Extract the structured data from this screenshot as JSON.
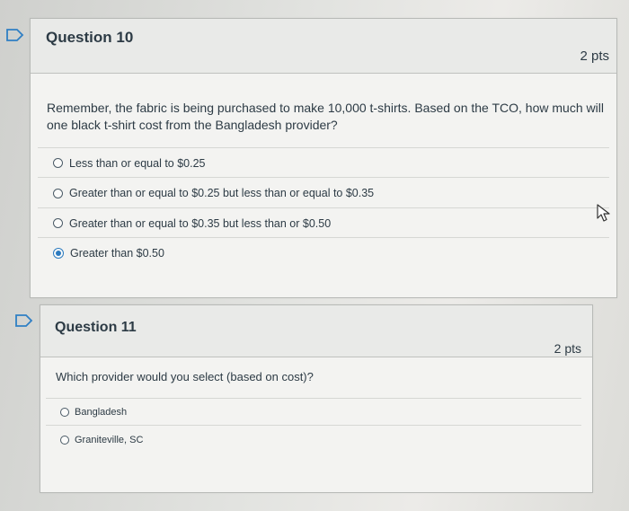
{
  "questions": [
    {
      "title": "Question 10",
      "points": "2 pts",
      "text": "Remember, the fabric is being purchased to make 10,000 t-shirts. Based on the TCO, how much will one black t-shirt cost from the Bangladesh provider?",
      "answers": [
        {
          "label": "Less than or equal to $0.25",
          "selected": false
        },
        {
          "label": "Greater than or equal to $0.25 but less than or equal to $0.35",
          "selected": false
        },
        {
          "label": "Greater than or equal to $0.35 but less than or $0.50",
          "selected": false
        },
        {
          "label": "Greater than $0.50",
          "selected": true
        }
      ]
    },
    {
      "title": "Question 11",
      "points": "2 pts",
      "text": "Which provider would you select (based on cost)?",
      "answers": [
        {
          "label": "Bangladesh",
          "selected": false
        },
        {
          "label": "Graniteville, SC",
          "selected": false
        }
      ]
    }
  ],
  "colors": {
    "accent": "#2b7abf",
    "flag": "#2f7fc4",
    "text": "#2d3b45"
  },
  "icons": {
    "flag": "flag-outline-icon",
    "cursor": "pointer-cursor-icon"
  }
}
